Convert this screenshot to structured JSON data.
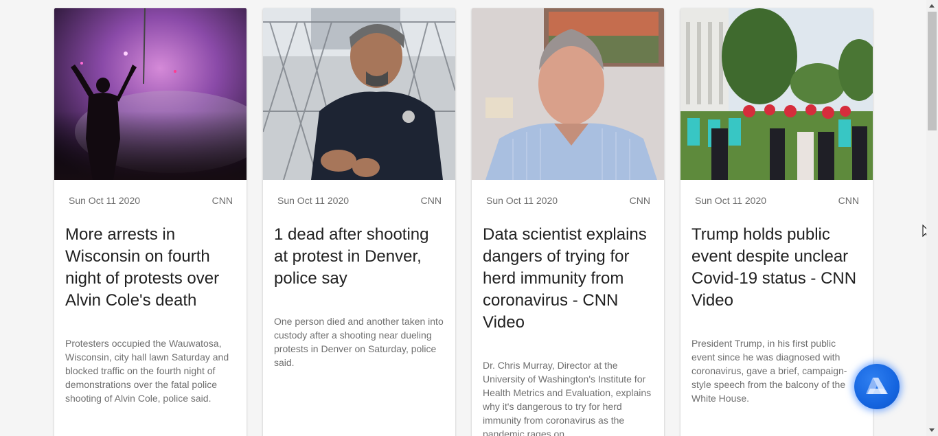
{
  "articles": [
    {
      "date": "Sun Oct 11 2020",
      "source": "CNN",
      "title": "More arrests in Wisconsin on fourth night of protests over Alvin Cole's death",
      "description": "Protesters occupied the Wauwatosa, Wisconsin, city hall lawn Saturday and blocked traffic on the fourth night of demonstrations over the fatal police shooting of Alvin Cole, police said."
    },
    {
      "date": "Sun Oct 11 2020",
      "source": "CNN",
      "title": "1 dead after shooting at protest in Denver, police say",
      "description": "One person died and another taken into custody after a shooting near dueling protests in Denver on Saturday, police said."
    },
    {
      "date": "Sun Oct 11 2020",
      "source": "CNN",
      "title": "Data scientist explains dangers of trying for herd immunity from coronavirus - CNN Video",
      "description": "Dr. Chris Murray, Director at the University of Washington's Institute for Health Metrics and Evaluation, explains why it's dangerous to try for herd immunity from coronavirus as the pandemic rages on."
    },
    {
      "date": "Sun Oct 11 2020",
      "source": "CNN",
      "title": "Trump holds public event despite unclear Covid-19 status - CNN Video",
      "description": "President Trump, in his first public event since he was diagnosed with coronavirus, gave a brief, campaign-style speech from the balcony of the White House."
    }
  ],
  "fab": {
    "icon": "app-logo-icon",
    "color": "#1565e0"
  },
  "colors": {
    "background": "#f5f5f5",
    "title": "#212121",
    "meta": "#6b6b6b",
    "description": "#6f6f6f"
  }
}
